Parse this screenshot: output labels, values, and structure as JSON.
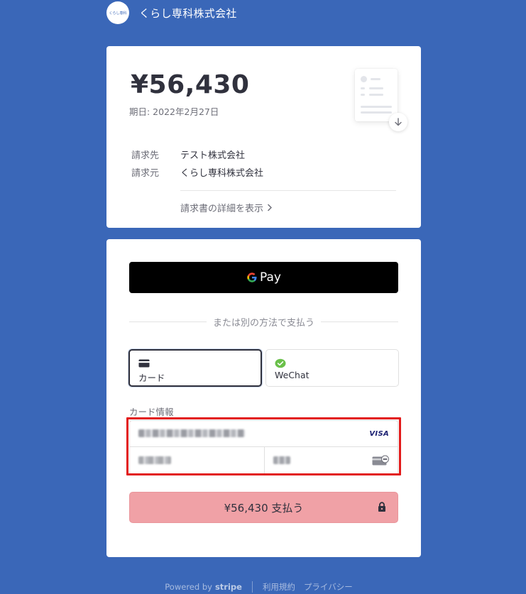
{
  "header": {
    "logo_text": "くらし専科",
    "merchant_name": "くらし専科株式会社"
  },
  "invoice": {
    "amount": "¥56,430",
    "due_date": "期日: 2022年2月27日",
    "bill_to_label": "請求先",
    "bill_to_value": "テスト株式会社",
    "bill_from_label": "請求元",
    "bill_from_value": "くらし専科株式会社",
    "details_link": "請求書の詳細を表示"
  },
  "payment": {
    "gpay_label": "Pay",
    "or_text": "または別の方法で支払う",
    "tabs": [
      {
        "label": "カード",
        "icon": "credit-card-icon",
        "selected": true
      },
      {
        "label": "WeChat",
        "icon": "wechat-icon",
        "selected": false
      }
    ],
    "card_info_label": "カード情報",
    "card_brand": "VISA",
    "pay_button_label": "¥56,430 支払う"
  },
  "footer": {
    "powered_by": "Powered by",
    "stripe": "stripe",
    "terms": "利用規約",
    "privacy": "プライバシー"
  },
  "colors": {
    "background": "#3a67b8",
    "pay_button": "#f0a1a6",
    "highlight_box": "#e21b1b",
    "wechat_green": "#6ac04a"
  }
}
